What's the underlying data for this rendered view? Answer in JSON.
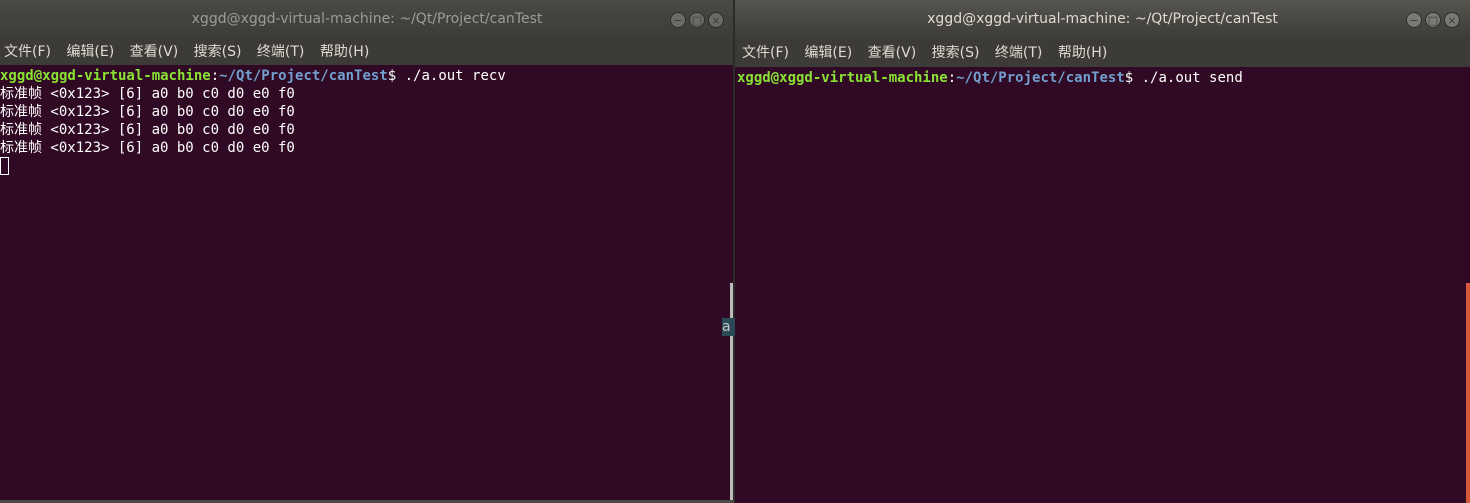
{
  "left_window": {
    "title": "xggd@xggd-virtual-machine: ~/Qt/Project/canTest",
    "menu": [
      "文件(F)",
      "编辑(E)",
      "查看(V)",
      "搜索(S)",
      "终端(T)",
      "帮助(H)"
    ],
    "prompt_user": "xggd@xggd-virtual-machine",
    "prompt_path": "~/Qt/Project/canTest",
    "prompt_symbol": "$",
    "command": "./a.out recv",
    "output_lines": [
      "标准帧 <0x123> [6] a0 b0 c0 d0 e0 f0",
      "标准帧 <0x123> [6] a0 b0 c0 d0 e0 f0",
      "标准帧 <0x123> [6] a0 b0 c0 d0 e0 f0",
      "标准帧 <0x123> [6] a0 b0 c0 d0 e0 f0"
    ]
  },
  "right_window": {
    "title": "xggd@xggd-virtual-machine: ~/Qt/Project/canTest",
    "menu": [
      "文件(F)",
      "编辑(E)",
      "查看(V)",
      "搜索(S)",
      "终端(T)",
      "帮助(H)"
    ],
    "prompt_user": "xggd@xggd-virtual-machine",
    "prompt_path": "~/Qt/Project/canTest",
    "prompt_symbol": "$",
    "command": "./a.out send"
  },
  "window_controls": {
    "minimize": "−",
    "maximize": "□",
    "close": "×"
  },
  "colors": {
    "terminal_bg": "#300a24",
    "prompt_user": "#8ae234",
    "prompt_path": "#729fcf",
    "scrollbar_active": "#d6573a"
  },
  "background_glyph": "a"
}
